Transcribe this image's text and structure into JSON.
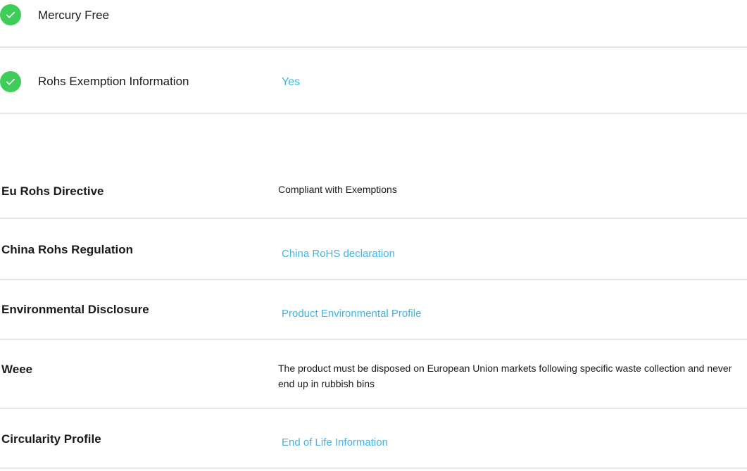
{
  "flags": [
    {
      "icon": "check-circle-icon",
      "label": "Mercury Free",
      "value": ""
    },
    {
      "icon": "check-circle-icon",
      "label": "Rohs Exemption Information",
      "value": "Yes"
    }
  ],
  "properties": [
    {
      "label": "Eu Rohs Directive",
      "value": "Compliant with Exemptions",
      "is_link": false
    },
    {
      "label": "China Rohs Regulation",
      "value": "China RoHS declaration",
      "is_link": true
    },
    {
      "label": "Environmental Disclosure",
      "value": "Product Environmental Profile",
      "is_link": true
    },
    {
      "label": "Weee",
      "value": "The product must be disposed on European Union markets following specific waste collection and never end up in rubbish bins",
      "is_link": false
    },
    {
      "label": "Circularity Profile",
      "value": "End of Life Information",
      "is_link": true
    }
  ],
  "colors": {
    "check": "#3dcd58",
    "link": "#42b4e6",
    "divider": "#e6e6e6",
    "text": "#1a1a1a"
  }
}
